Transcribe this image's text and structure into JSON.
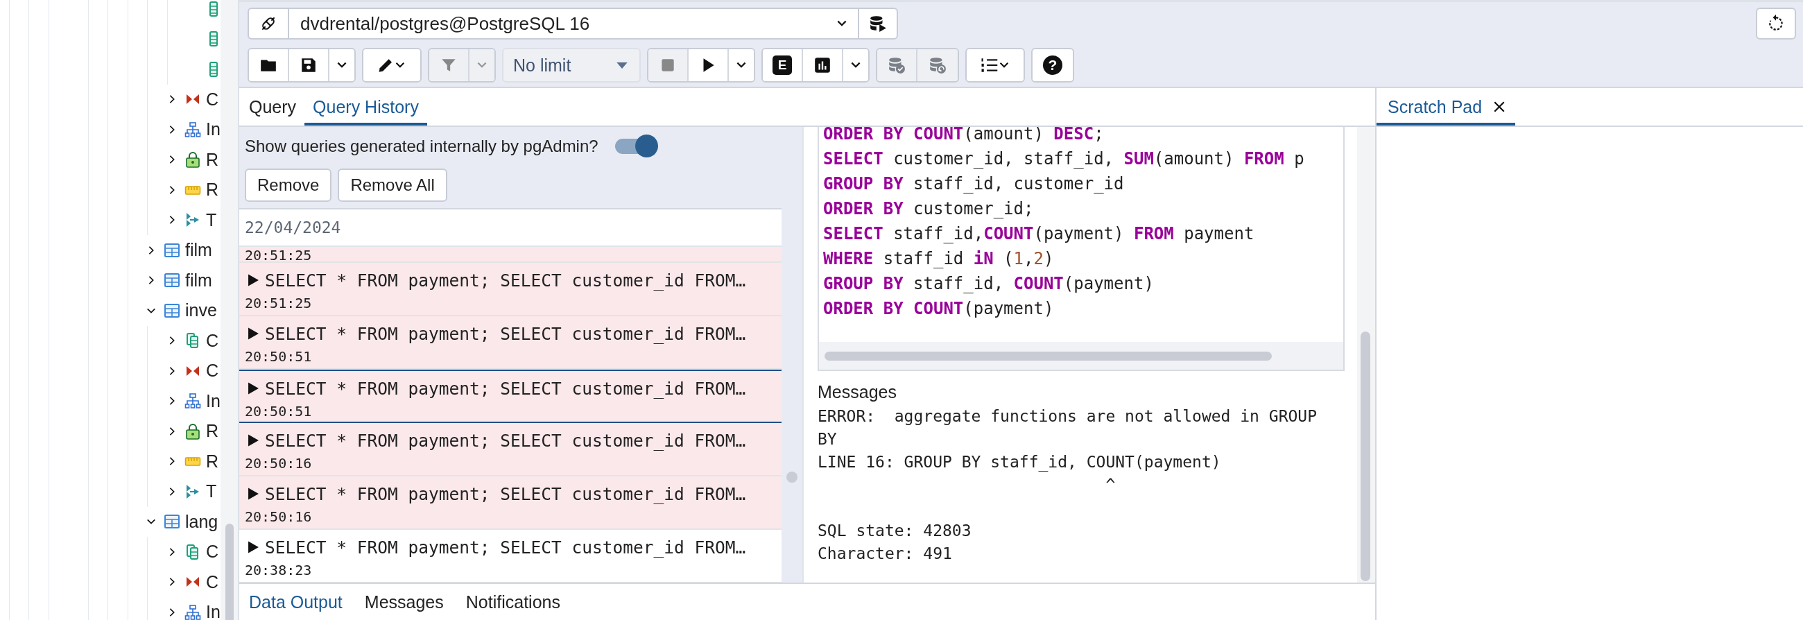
{
  "sidebar": {
    "tree": [
      {
        "kind": "group",
        "children": [
          {
            "kind": "group",
            "children": [
              {
                "kind": "column"
              },
              {
                "kind": "column"
              },
              {
                "kind": "column"
              }
            ]
          },
          {
            "kind": "constraints",
            "label": "C",
            "expanded": false
          },
          {
            "kind": "indexes",
            "label": "In",
            "expanded": false
          },
          {
            "kind": "policies",
            "label": "R",
            "expanded": false
          },
          {
            "kind": "rules",
            "label": "R",
            "expanded": false
          },
          {
            "kind": "triggers",
            "label": "T",
            "expanded": false
          }
        ]
      },
      {
        "kind": "table",
        "label": "film",
        "expanded": false
      },
      {
        "kind": "table",
        "label": "film",
        "expanded": false
      },
      {
        "kind": "table",
        "label": "inve",
        "expanded": true,
        "children": [
          {
            "kind": "columns",
            "label": "C",
            "expanded": false
          },
          {
            "kind": "constraints",
            "label": "C",
            "expanded": false
          },
          {
            "kind": "indexes",
            "label": "In",
            "expanded": false
          },
          {
            "kind": "policies",
            "label": "R",
            "expanded": false
          },
          {
            "kind": "rules",
            "label": "R",
            "expanded": false
          },
          {
            "kind": "triggers",
            "label": "T",
            "expanded": false
          }
        ]
      },
      {
        "kind": "table",
        "label": "lang",
        "expanded": true,
        "children": [
          {
            "kind": "columns",
            "label": "C",
            "expanded": false
          },
          {
            "kind": "constraints",
            "label": "C",
            "expanded": false
          },
          {
            "kind": "indexes",
            "label": "In",
            "expanded": false
          }
        ]
      }
    ]
  },
  "toolbar": {
    "connection": "dvdrental/postgres@PostgreSQL 16",
    "groups": [
      [
        {
          "kind": "open",
          "disabled": false
        },
        {
          "kind": "save",
          "disabled": false
        },
        {
          "kind": "caret",
          "disabled": false
        }
      ],
      [
        {
          "kind": "edit",
          "disabled": false
        }
      ],
      [
        {
          "kind": "filter",
          "disabled": true
        },
        {
          "kind": "caret",
          "disabled": true
        }
      ],
      [
        {
          "kind": "limit",
          "label": "No limit",
          "disabled": false
        }
      ],
      [
        {
          "kind": "stop",
          "disabled": true
        },
        {
          "kind": "execute",
          "disabled": false
        },
        {
          "kind": "caret",
          "disabled": false
        }
      ],
      [
        {
          "kind": "explain",
          "label": "E",
          "disabled": false
        },
        {
          "kind": "analyze",
          "disabled": false
        },
        {
          "kind": "caret",
          "disabled": false
        }
      ],
      [
        {
          "kind": "commit",
          "disabled": true
        },
        {
          "kind": "rollback",
          "disabled": true
        }
      ],
      [
        {
          "kind": "macros",
          "disabled": false
        }
      ],
      [
        {
          "kind": "help",
          "label": "?",
          "disabled": false
        }
      ]
    ]
  },
  "query_panel": {
    "tabs": [
      {
        "label": "Query",
        "selected": false
      },
      {
        "label": "Query History",
        "selected": true
      }
    ],
    "history": {
      "toggle": {
        "label": "Show queries generated internally by pgAdmin?",
        "on": true
      },
      "buttons": [
        "Remove",
        "Remove All"
      ],
      "date": "22/04/2024",
      "entries": [
        {
          "time": "20:51:25",
          "error": true,
          "selected": false
        },
        {
          "query": "SELECT * FROM payment; SELECT customer_id FROM…",
          "time": "20:51:25",
          "error": true,
          "selected": false
        },
        {
          "query": "SELECT * FROM payment; SELECT customer_id FROM…",
          "time": "20:50:51",
          "error": true,
          "selected": false
        },
        {
          "query": "SELECT * FROM payment; SELECT customer_id FROM…",
          "time": "20:50:51",
          "error": true,
          "selected": true
        },
        {
          "query": "SELECT * FROM payment; SELECT customer_id FROM…",
          "time": "20:50:16",
          "error": true,
          "selected": false
        },
        {
          "query": "SELECT * FROM payment; SELECT customer_id FROM…",
          "time": "20:50:16",
          "error": true,
          "selected": false
        },
        {
          "query": "SELECT * FROM payment; SELECT customer_id FROM…",
          "time": "20:38:23",
          "error": false,
          "selected": false
        }
      ]
    },
    "code": [
      [
        {
          "text": "ORDER BY COUNT",
          "kind": "keyword"
        },
        {
          "text": "(amount) ",
          "kind": "plain"
        },
        {
          "text": "DESC",
          "kind": "keyword"
        },
        {
          "text": ";",
          "kind": "plain"
        }
      ],
      [
        {
          "text": "SELECT",
          "kind": "keyword"
        },
        {
          "text": " customer_id, staff_id, ",
          "kind": "plain"
        },
        {
          "text": "SUM",
          "kind": "keyword"
        },
        {
          "text": "(amount) ",
          "kind": "plain"
        },
        {
          "text": "FROM",
          "kind": "keyword"
        },
        {
          "text": " p",
          "kind": "plain"
        }
      ],
      [
        {
          "text": "GROUP BY",
          "kind": "keyword"
        },
        {
          "text": " staff_id, customer_id",
          "kind": "plain"
        }
      ],
      [
        {
          "text": "ORDER BY",
          "kind": "keyword"
        },
        {
          "text": " customer_id;",
          "kind": "plain"
        }
      ],
      [
        {
          "text": "SELECT",
          "kind": "keyword"
        },
        {
          "text": " staff_id,",
          "kind": "plain"
        },
        {
          "text": "COUNT",
          "kind": "keyword"
        },
        {
          "text": "(payment) ",
          "kind": "plain"
        },
        {
          "text": "FROM",
          "kind": "keyword"
        },
        {
          "text": " payment",
          "kind": "plain"
        }
      ],
      [
        {
          "text": "WHERE",
          "kind": "keyword"
        },
        {
          "text": " staff_id ",
          "kind": "plain"
        },
        {
          "text": "iN",
          "kind": "keyword"
        },
        {
          "text": " (",
          "kind": "plain"
        },
        {
          "text": "1",
          "kind": "number"
        },
        {
          "text": ",",
          "kind": "plain"
        },
        {
          "text": "2",
          "kind": "number"
        },
        {
          "text": ")",
          "kind": "plain"
        }
      ],
      [
        {
          "text": "GROUP BY",
          "kind": "keyword"
        },
        {
          "text": " staff_id, ",
          "kind": "plain"
        },
        {
          "text": "COUNT",
          "kind": "keyword"
        },
        {
          "text": "(payment)",
          "kind": "plain"
        }
      ],
      [
        {
          "text": "ORDER BY COUNT",
          "kind": "keyword"
        },
        {
          "text": "(payment)",
          "kind": "plain"
        }
      ]
    ],
    "messages_heading": "Messages",
    "messages": "ERROR:  aggregate functions are not allowed in GROUP BY\nLINE 16: GROUP BY staff_id, COUNT(payment)\n                              ^\n\nSQL state: 42803\nCharacter: 491",
    "output_tabs": [
      {
        "label": "Data Output",
        "selected": true
      },
      {
        "label": "Messages",
        "selected": false
      },
      {
        "label": "Notifications",
        "selected": false
      }
    ]
  },
  "scratch_pad": {
    "tab": {
      "label": "Scratch Pad",
      "selected": true
    }
  }
}
